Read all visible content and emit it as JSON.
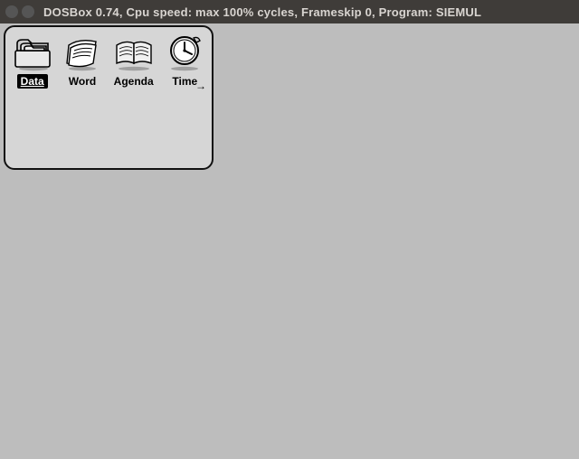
{
  "window": {
    "title": "DOSBox 0.74, Cpu speed: max 100% cycles, Frameskip  0, Program:   SIEMUL"
  },
  "launcher": {
    "apps": [
      {
        "id": "data",
        "label": "Data",
        "selected": true
      },
      {
        "id": "word",
        "label": "Word",
        "selected": false
      },
      {
        "id": "agenda",
        "label": "Agenda",
        "selected": false
      },
      {
        "id": "time",
        "label": "Time",
        "selected": false
      }
    ],
    "scroll_right_glyph": "→"
  }
}
